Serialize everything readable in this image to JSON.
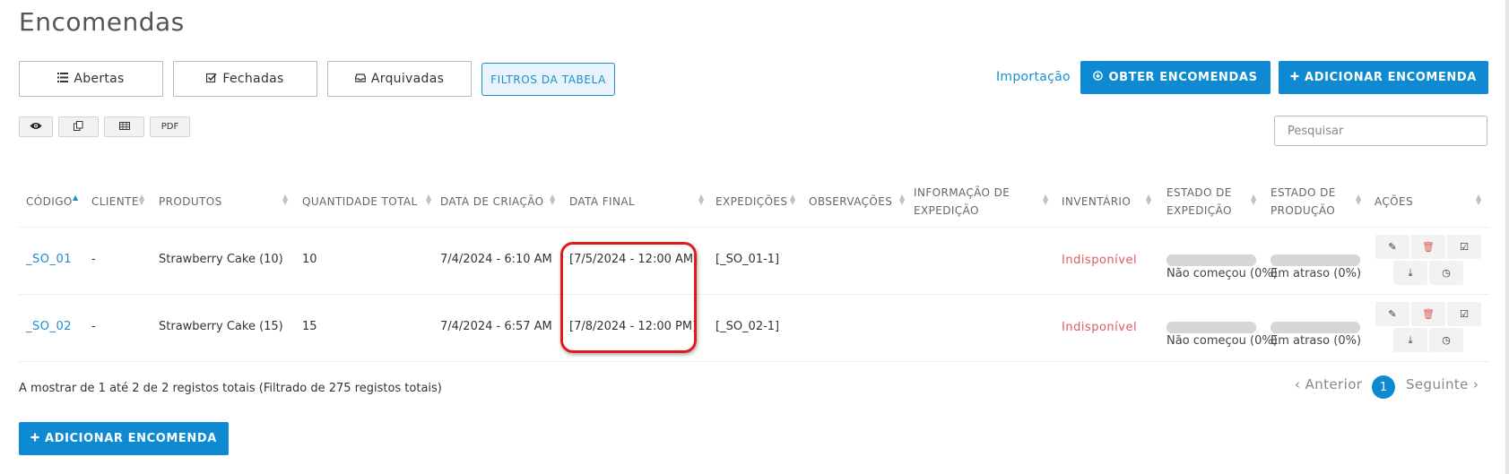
{
  "page": {
    "title": "Encomendas"
  },
  "tabs": [
    {
      "label": "Abertas",
      "icon": "list-icon"
    },
    {
      "label": "Fechadas",
      "icon": "checkbox-icon"
    },
    {
      "label": "Arquivadas",
      "icon": "inbox-icon"
    }
  ],
  "toolbar": {
    "filters_label": "FILTROS DA TABELA",
    "import_label": "Importação",
    "get_orders_label": "OBTER ENCOMENDAS",
    "add_order_label": "ADICIONAR ENCOMENDA",
    "export_buttons": [
      {
        "label": "",
        "icon": "eye-icon"
      },
      {
        "label": "",
        "icon": "copy-icon"
      },
      {
        "label": "",
        "icon": "table-icon"
      },
      {
        "label": "PDF",
        "icon": ""
      }
    ],
    "search_placeholder": "Pesquisar"
  },
  "table": {
    "columns": [
      {
        "line1": "CÓDIGO",
        "line2": "",
        "sort": "asc"
      },
      {
        "line1": "CLIENTE",
        "line2": "",
        "sort": "none"
      },
      {
        "line1": "PRODUTOS",
        "line2": "",
        "sort": "none"
      },
      {
        "line1": "QUANTIDADE TOTAL",
        "line2": "",
        "sort": "none"
      },
      {
        "line1": "DATA DE CRIAÇÃO",
        "line2": "",
        "sort": "none"
      },
      {
        "line1": "DATA FINAL",
        "line2": "",
        "sort": "none"
      },
      {
        "line1": "EXPEDIÇÕES",
        "line2": "",
        "sort": "none"
      },
      {
        "line1": "OBSERVAÇÕES",
        "line2": "",
        "sort": "none"
      },
      {
        "line1": "INFORMAÇÃO DE",
        "line2": "EXPEDIÇÃO",
        "sort": "none"
      },
      {
        "line1": "INVENTÁRIO",
        "line2": "",
        "sort": "none"
      },
      {
        "line1": "ESTADO DE",
        "line2": "EXPEDIÇÃO",
        "sort": "none"
      },
      {
        "line1": "ESTADO DE",
        "line2": "PRODUÇÃO",
        "sort": "none"
      },
      {
        "line1": "AÇÕES",
        "line2": "",
        "sort": "none"
      }
    ],
    "rows": [
      {
        "code": "_SO_01",
        "client": "-",
        "products": "Strawberry Cake (10)",
        "quantity": "10",
        "created": "7/4/2024 - 6:10 AM",
        "final_date": "[7/5/2024 - 12:00 AM]",
        "expeditions": "[_SO_01-1]",
        "observations": "",
        "expedition_info": "",
        "inventory": "Indisponível",
        "expedition_state": {
          "label": "Não começou (0%)",
          "progress": 0
        },
        "production_state": {
          "label": "Em atraso (0%)",
          "progress": 0
        }
      },
      {
        "code": "_SO_02",
        "client": "-",
        "products": "Strawberry Cake (15)",
        "quantity": "15",
        "created": "7/4/2024 - 6:57 AM",
        "final_date": "[7/8/2024 - 12:00 PM]",
        "expeditions": "[_SO_02-1]",
        "observations": "",
        "expedition_info": "",
        "inventory": "Indisponível",
        "expedition_state": {
          "label": "Não começou (0%)",
          "progress": 0
        },
        "production_state": {
          "label": "Em atraso (0%)",
          "progress": 0
        }
      }
    ],
    "action_icons": [
      "edit-icon",
      "trash-icon",
      "check-square-icon",
      "download-icon",
      "clock-icon"
    ]
  },
  "footer": {
    "info": "A mostrar de 1 até 2 de 2 registos totais (Filtrado de 275 registos totais)",
    "prev_label": "Anterior",
    "current_page": "1",
    "next_label": "Seguinte",
    "add_order_label": "ADICIONAR ENCOMENDA"
  },
  "colors": {
    "accent": "#0e8ad2",
    "danger": "#e25a5a",
    "highlight": "#e01b1b"
  }
}
